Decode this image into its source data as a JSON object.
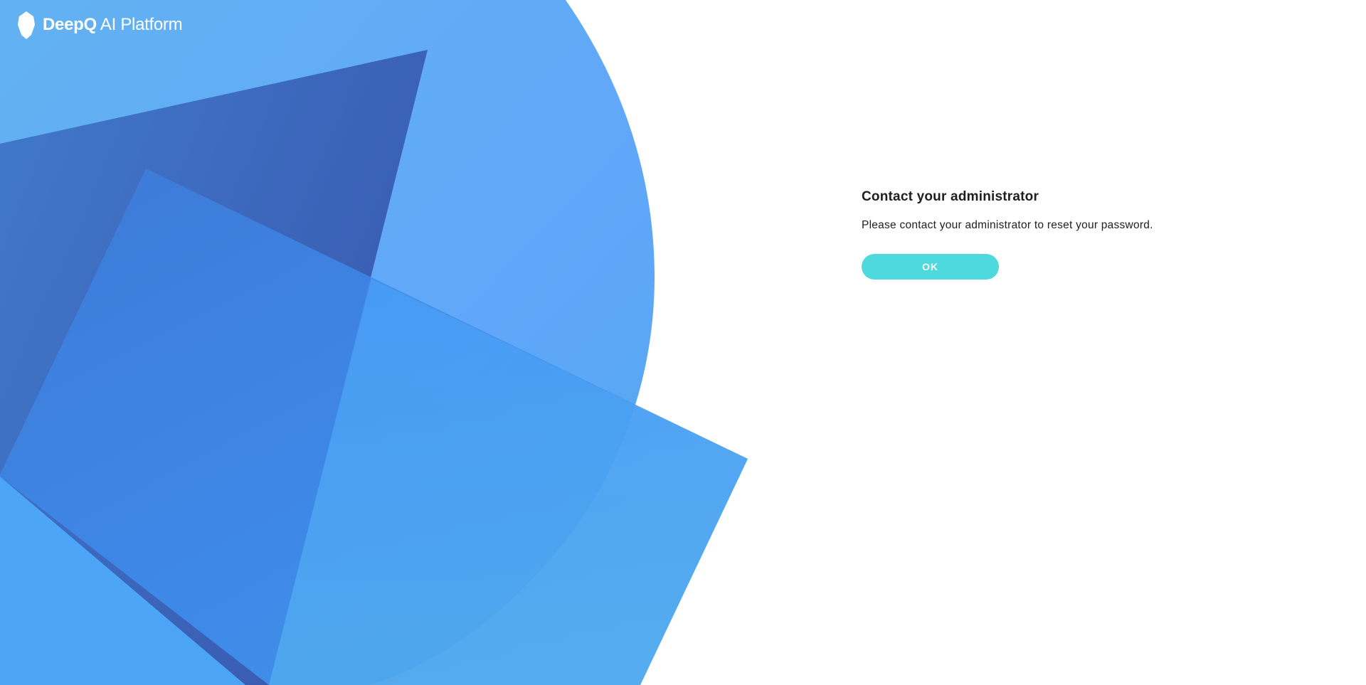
{
  "brand": {
    "name_strong": "DeepQ",
    "name_light": "AI Platform",
    "icon": "deepq-crystal-logo-icon"
  },
  "dialog": {
    "title": "Contact your administrator",
    "message": "Please contact your administrator to reset your password.",
    "ok_label": "OK"
  },
  "colors": {
    "background": "#ffffff",
    "accent_button": "#4ed9de",
    "hero_light_blue": "#62aaf4",
    "hero_dark_blue": "#3a5fb6",
    "hero_mid_blue": "#459ef5"
  }
}
